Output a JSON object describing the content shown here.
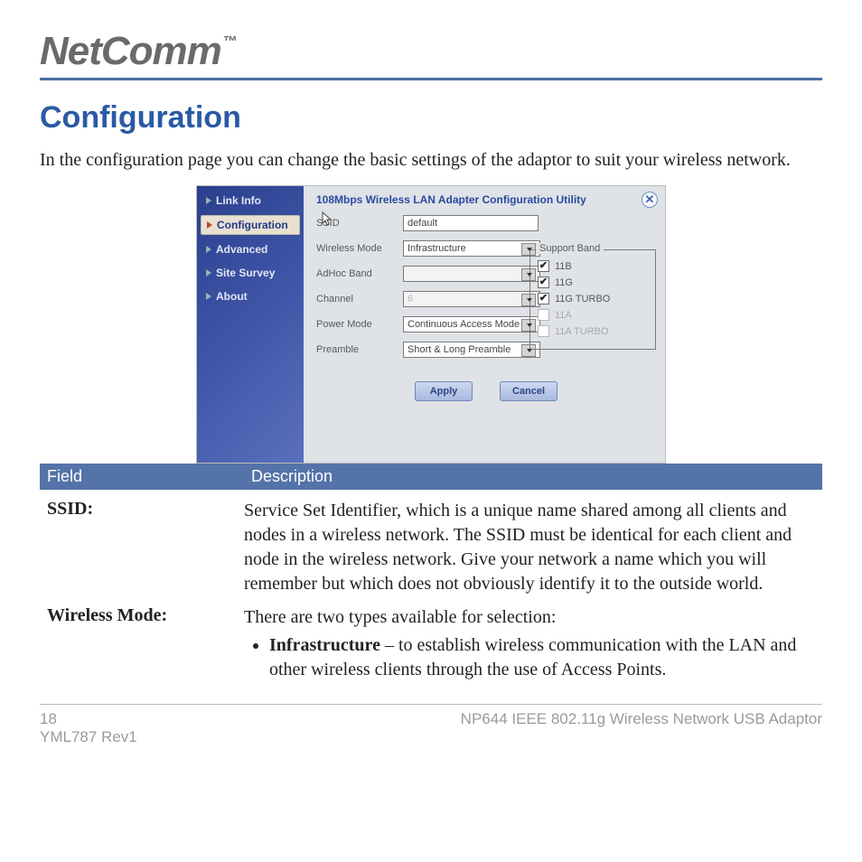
{
  "brand": "NetComm",
  "brand_tm": "™",
  "page_title": "Configuration",
  "intro": "In the configuration page you can change the basic settings of the adaptor to suit your wireless network.",
  "shot": {
    "title": "108Mbps Wireless LAN Adapter Configuration Utility",
    "nav": [
      "Link Info",
      "Configuration",
      "Advanced",
      "Site Survey",
      "About"
    ],
    "active_nav": "Configuration",
    "fields": {
      "ssid_label": "SSID",
      "ssid_value": "default",
      "mode_label": "Wireless Mode",
      "mode_value": "Infrastructure",
      "adhoc_label": "AdHoc Band",
      "adhoc_value": "",
      "channel_label": "Channel",
      "channel_value": "6",
      "power_label": "Power Mode",
      "power_value": "Continuous Access Mode",
      "preamble_label": "Preamble",
      "preamble_value": "Short & Long Preamble"
    },
    "band_legend": "Support Band",
    "bands": [
      {
        "label": "11B",
        "checked": true,
        "disabled": false
      },
      {
        "label": "11G",
        "checked": true,
        "disabled": false
      },
      {
        "label": "11G TURBO",
        "checked": true,
        "disabled": false
      },
      {
        "label": "11A",
        "checked": false,
        "disabled": true
      },
      {
        "label": "11A TURBO",
        "checked": false,
        "disabled": true
      }
    ],
    "apply": "Apply",
    "cancel": "Cancel"
  },
  "table": {
    "h1": "Field",
    "h2": "Description",
    "rows": [
      {
        "field": "SSID:",
        "desc": "Service Set Identifier, which is a unique name shared among all clients and nodes in a wireless network. The SSID must be identical for each client and node in the wireless network.  Give your network a name which you will remember but which does not obviously identify it to the outside world."
      },
      {
        "field": "Wireless Mode:",
        "desc_intro": "There are two types available for selection:",
        "bullets": [
          {
            "bold": "Infrastructure",
            "rest": " – to establish wireless communication with the LAN and other wireless clients through the use of Access Points."
          }
        ]
      }
    ]
  },
  "footer": {
    "page": "18",
    "rev": "YML787 Rev1",
    "product": "NP644 IEEE 802.11g  Wireless Network USB Adaptor"
  }
}
